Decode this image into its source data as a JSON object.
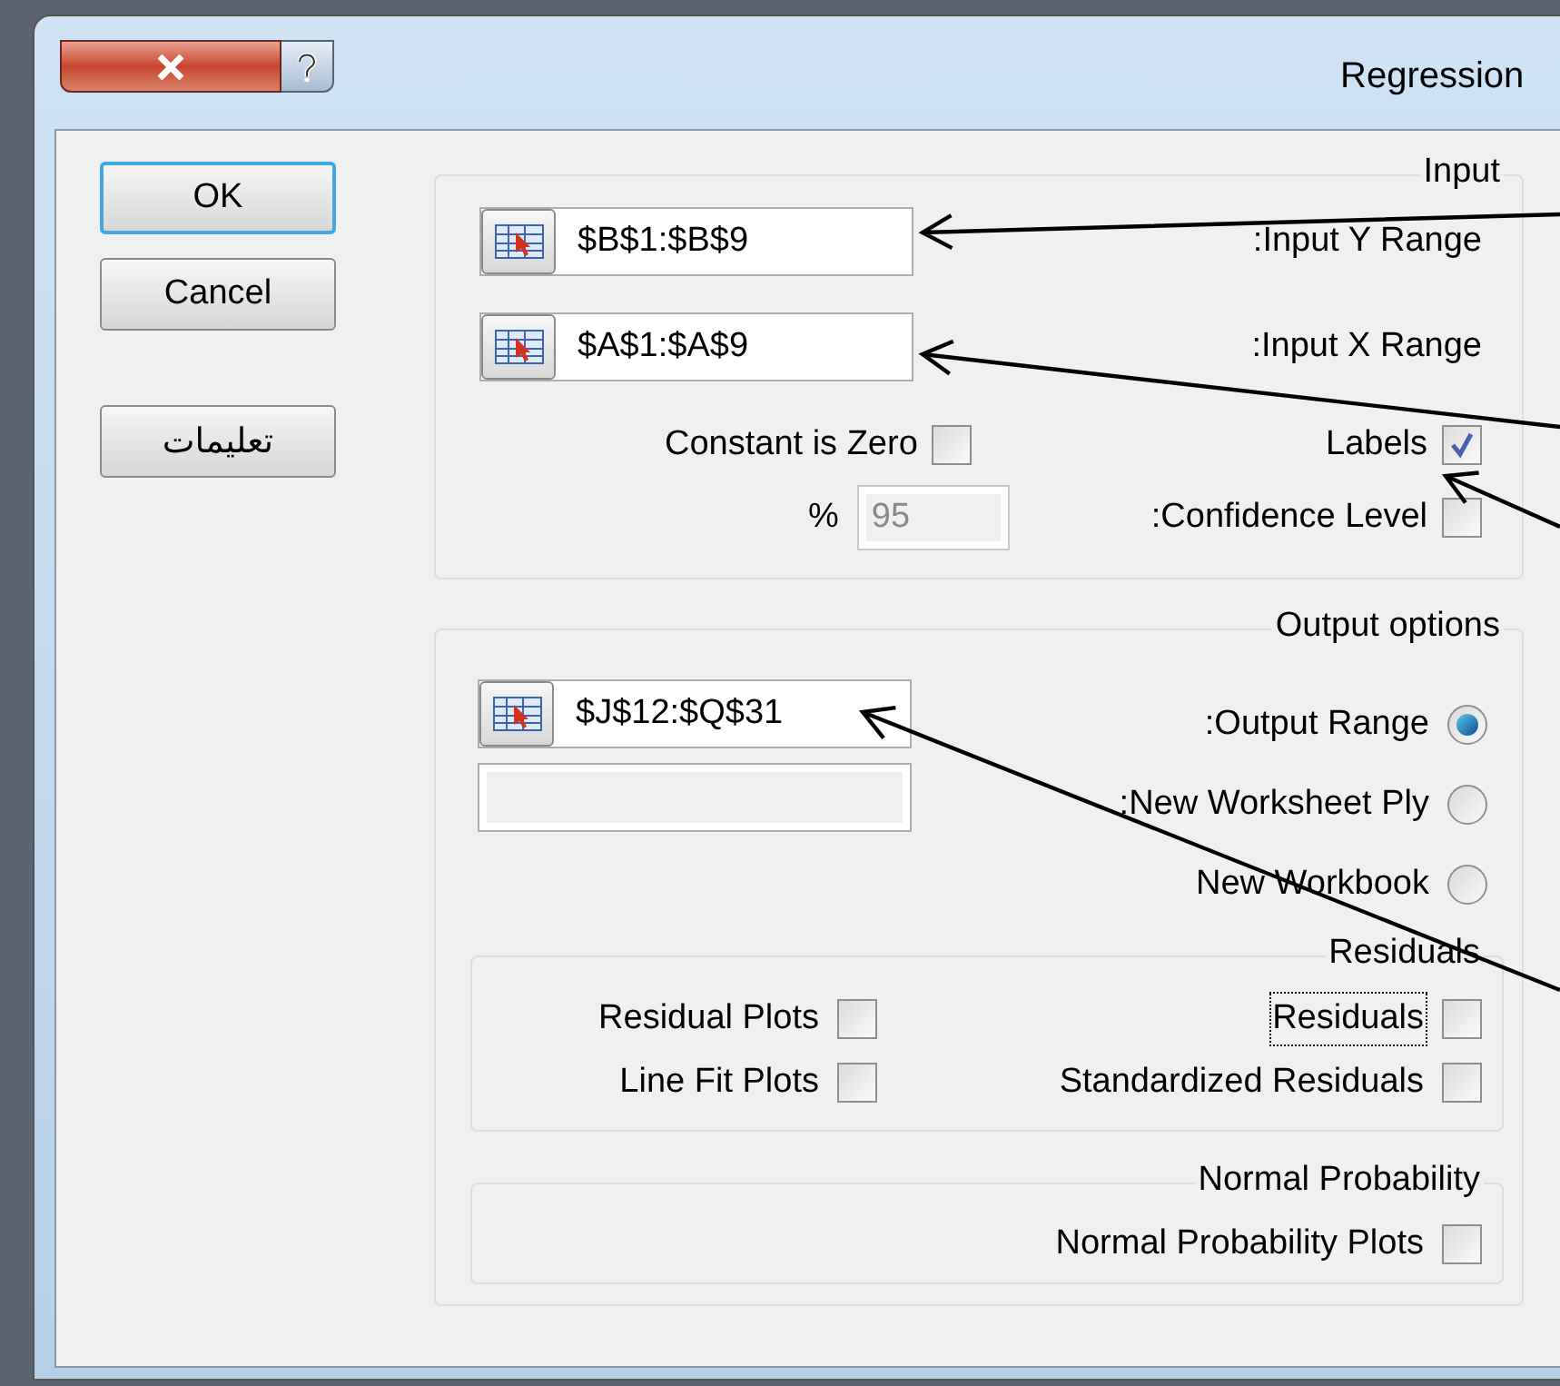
{
  "window": {
    "title": "Regression"
  },
  "buttons": [
    {
      "label": "OK",
      "default": true
    },
    {
      "label": "Cancel",
      "default": false
    },
    {
      "label": "تعليمات",
      "default": false
    }
  ],
  "input": {
    "legend": "Input",
    "ranges": [
      {
        "label": ":Input Y Range",
        "value": "$B$1:$B$9"
      },
      {
        "label": ":Input X Range",
        "value": "$A$1:$A$9"
      }
    ],
    "options": [
      {
        "label": "Constant is Zero",
        "checked": false
      },
      {
        "label": "Labels",
        "checked": true
      }
    ],
    "confidence": {
      "label": ":Confidence Level",
      "checked": false,
      "unit": "%",
      "value": "95",
      "disabled": true
    }
  },
  "output": {
    "legend": "Output options",
    "choices": [
      {
        "label": ":Output Range",
        "selected": true
      },
      {
        "label": ":New Worksheet Ply",
        "selected": false
      },
      {
        "label": "New Workbook",
        "selected": false
      }
    ],
    "output_range": {
      "value": "$J$12:$Q$31"
    },
    "sheet_name": {
      "disabled": true
    },
    "residuals": {
      "legend": "Residuals",
      "rows": [
        {
          "left": {
            "label": "Residual Plots",
            "checked": false,
            "focused": false
          },
          "right": {
            "label": "Residuals",
            "checked": false,
            "focused": true
          }
        },
        {
          "left": {
            "label": "Line Fit Plots",
            "checked": false,
            "focused": false
          },
          "right": {
            "label": "Standardized Residuals",
            "checked": false,
            "focused": false
          }
        }
      ]
    },
    "normal_probability": {
      "legend": "Normal Probability",
      "items": [
        {
          "label": "Normal Probability Plots",
          "checked": false,
          "focused": false
        }
      ]
    }
  }
}
